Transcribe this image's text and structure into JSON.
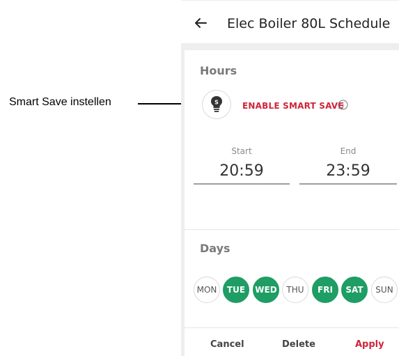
{
  "annotation": {
    "label": "Smart Save instellen"
  },
  "header": {
    "title": "Elec Boiler 80L Schedule",
    "back_icon": "arrow-left-icon"
  },
  "hours": {
    "title": "Hours",
    "smart_save_label": "ENABLE SMART SAVE",
    "bulb_icon": "smart-save-bulb-icon",
    "info_icon": "info-icon",
    "start": {
      "label": "Start",
      "value": "20:59"
    },
    "end": {
      "label": "End",
      "value": "23:59"
    }
  },
  "days": {
    "title": "Days",
    "items": [
      {
        "label": "MON",
        "selected": false
      },
      {
        "label": "TUE",
        "selected": true
      },
      {
        "label": "WED",
        "selected": true
      },
      {
        "label": "THU",
        "selected": false
      },
      {
        "label": "FRI",
        "selected": true
      },
      {
        "label": "SAT",
        "selected": true
      },
      {
        "label": "SUN",
        "selected": false
      }
    ]
  },
  "actions": {
    "cancel": "Cancel",
    "delete": "Delete",
    "apply": "Apply"
  },
  "colors": {
    "accent_red": "#d0253a",
    "day_selected": "#1e9d64",
    "background": "#eeeeee"
  }
}
